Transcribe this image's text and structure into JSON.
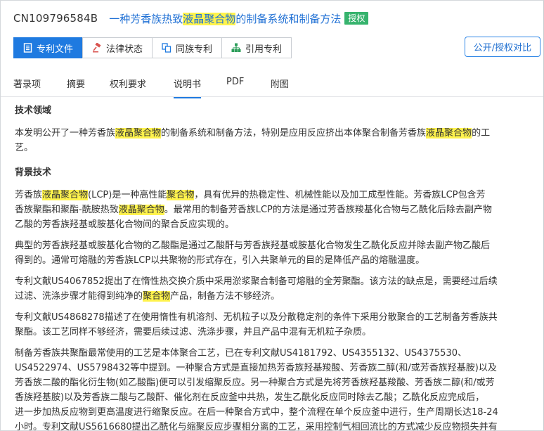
{
  "header": {
    "patent_number": "CN109796584B",
    "title_pre": "一种芳香族热致",
    "title_hl": "液晶聚合物",
    "title_post": "的制备系统和制备方法",
    "status": "授权"
  },
  "nav_tabs": [
    {
      "label": "专利文件",
      "icon": "document-icon"
    },
    {
      "label": "法律状态",
      "icon": "gavel-icon"
    },
    {
      "label": "同族专利",
      "icon": "family-icon"
    },
    {
      "label": "引用专利",
      "icon": "hierarchy-icon"
    }
  ],
  "compare_button": "公开/授权对比",
  "section_tabs": [
    "著录项",
    "摘要",
    "权利要求",
    "说明书",
    "PDF",
    "附图"
  ],
  "content": {
    "h1": "技术领域",
    "p1": {
      "a": "本发明公开了一种芳香族",
      "b": "液晶聚合物",
      "c": "的制备系统和制备方法，特别是应用反应挤出本体聚合制备芳香族",
      "d": "液晶聚合物",
      "e": "的工",
      "f": "艺。"
    },
    "h2": "背景技术",
    "p2": {
      "l1a": "芳香族",
      "l1b": "液晶聚合物",
      "l1c": "(LCP)是一种高性能",
      "l1d": "聚合物",
      "l1e": "，具有优异的热稳定性、机械性能以及加工成型性能。芳香族LCP包含芳",
      "l2a": "香族聚酯和聚酯-酰胺热致",
      "l2b": "液晶聚合物",
      "l2c": "。最常用的制备芳香族LCP的方法是通过芳香族羧基化合物与乙酰化后除去副产物",
      "l3": "乙酸的芳香族羟基或胺基化合物间的聚合反应实现的。"
    },
    "p3": {
      "l1": "典型的芳香族羟基或胺基化合物的乙酸酯是通过乙酸酐与芳香族羟基或胺基化合物发生乙酰化反应并除去副产物乙酸后",
      "l2": "得到的。通常可熔融的芳香族LCP以共聚物的形式存在，引入共聚单元的目的是降低产品的熔融温度。"
    },
    "p4": {
      "l1": "专利文献US4067852提出了在惰性热交换介质中采用淤浆聚合制备可熔融的全芳聚酯。该方法的缺点是，需要经过后续",
      "l2a": "过滤、洗涤步骤才能得到纯净的",
      "l2b": "聚合物",
      "l2c": "产品，制备方法不够经济。"
    },
    "p5": {
      "l1": "专利文献US4868278描述了在使用惰性有机溶剂、无机粒子以及分散稳定剂的条件下采用分散聚合的工艺制备芳香族共",
      "l2": "聚酯。该工艺同样不够经济，需要后续过滤、洗涤步骤，并且产品中混有无机粒子杂质。"
    },
    "p6": {
      "l1": "制备芳香族共聚酯最常使用的工艺是本体聚合工艺，已在专利文献US4181792、US4355132、US4375530、",
      "l2": "US4522974、US5798432等中提到。一种聚合方式是直接加热芳香族羟基羧酸、芳香族二醇(和/或芳香族羟基胺)以及",
      "l3": "芳香族二酸的酯化衍生物(如乙酸酯)便可以引发缩聚反应。另一种聚合方式是先将芳香族羟基羧酸、芳香族二醇(和/或芳",
      "l4": "香族羟基胺)以及芳香族二酸与乙酸酐、催化剂在反应釜中共热，发生乙酰化反应同时除去乙酸；乙酰化反应完成后，",
      "l5": "进一步加热反应物到更高温度进行缩聚反应。在后一种聚合方式中，整个流程在单个反应釜中进行，生产周期长达18-24",
      "l6": "小时。专利文献US5616680提出乙酰化与缩聚反应步骤相分离的工艺，采用控制气相回流比的方式减少反应物损失并有"
    }
  }
}
